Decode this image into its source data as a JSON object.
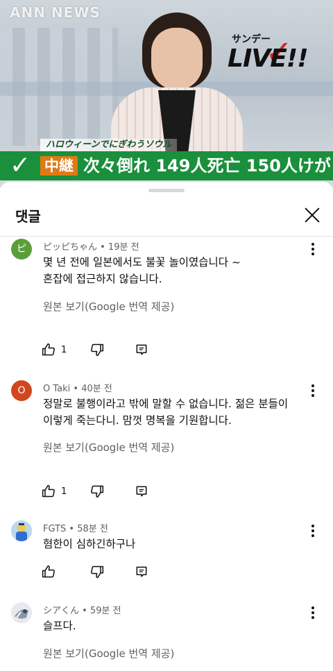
{
  "video": {
    "network_logo": "ANN NEWS",
    "show_logo_small": "サンデー",
    "show_logo_big": "LIVE!!",
    "ticker_top": "ハロウィーンでにぎわうソウル",
    "ticker_tag": "中継",
    "ticker_headline": "次々倒れ 149人死亡 150人けが",
    "accent_green": "#1a8f3c",
    "accent_orange": "#e07a14"
  },
  "sheet": {
    "title": "댓글",
    "close_icon": "close-icon"
  },
  "comments": [
    {
      "author": "ピッピちゃん",
      "time": "19분 전",
      "meta": "ピッピちゃん • 19분 전",
      "avatar_letter": "ピ",
      "avatar_color": "#5a9e3a",
      "text_line1": "몇 년 전에 일본에서도 불꽃 놀이였습니다 ~",
      "text_line2": "혼잡에 접근하지 않습니다.",
      "translate": "원본 보기(Google 번역 제공)",
      "likes": "1"
    },
    {
      "author": "O Taki",
      "time": "40분 전",
      "meta": "O Taki • 40분 전",
      "avatar_letter": "O",
      "avatar_color": "#d2461e",
      "text_line1": "정말로 불행이라고 밖에 말할 수 없습니다. 젊은 분들이",
      "text_line2": "이렇게 죽는다니. 맘껏 명복을 기원합니다.",
      "translate": "원본 보기(Google 번역 제공)",
      "likes": "1"
    },
    {
      "author": "FGTS",
      "time": "58분 전",
      "meta": "FGTS • 58분 전",
      "text_line1": "혐한이 심하긴하구나"
    },
    {
      "author": "シアくん",
      "time": "59분 전",
      "meta": "シアくん • 59분 전",
      "text_line1": "슬프다.",
      "translate": "원본 보기(Google 번역 제공)"
    }
  ]
}
